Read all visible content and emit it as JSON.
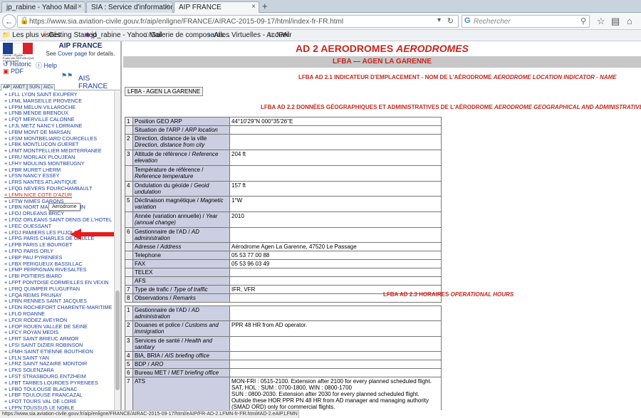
{
  "browser": {
    "tabs": [
      {
        "label": "jp_rabine - Yahoo Mail",
        "active": false
      },
      {
        "label": "SIA : Service d'information aéro...",
        "active": false
      },
      {
        "label": "AIP FRANCE",
        "active": true
      }
    ],
    "new_tab_label": "+",
    "tab_close": "×",
    "url": "https://www.sia.aviation-civile.gouv.fr/aip/enligne/FRANCE/AIRAC-2015-09-17/html/index-fr-FR.html",
    "search_placeholder": "Rechercher",
    "bookmarks": [
      "Les plus visités",
      "Getting Started",
      "jp_rabine - Yahoo Mail",
      "Galerie de composants...",
      "Ailes Virtuelles - Accueil",
      "JPAir"
    ],
    "status_url": "https://www.sia.aviation-civile.gouv.fr/aip/enligne/FRANCE/AIRAC-2015-09-17/html/eAIP/FR-AD-2.LFMN-fr-FR.html#AD-2.eAIP.LFMN"
  },
  "left": {
    "flag_caption": "Liberté • Égalité • Fraternité RÉPUBLIQUE FRANÇAISE",
    "title": "AIP FRANCE",
    "cover_prefix": "See ",
    "cover_link": "Cover page",
    "cover_suffix": " for details.",
    "historic": "Historic",
    "help": "Help",
    "pdf": "PDF",
    "ais_france": "AIS FRANCE",
    "tabs": [
      "AIP",
      "AMDT",
      "SUPs",
      "AICs"
    ],
    "items": [
      "LFLL LYON SAINT EXUPERY",
      "LFML MARSEILLE PROVENCE",
      "LFPM MELUN VILLAROCHE",
      "LFNB MENDE BRENOUX",
      "LFQT MERVILLE CALONNE",
      "LFJL METZ NANCY LORRAINE",
      "LFBM MONT DE MARSAN",
      "LFSM MONTBELIARD COURCELLES",
      "LFBK MONTLUCON GUERET",
      "LFMT MONTPELLIER MEDITERRANEE",
      "LFRU MORLAIX PLOUJEAN",
      "LFHY MOULINS MONTBEUGNY",
      "LFBR MURET LHERM",
      "LFSN NANCY ESSEY",
      "LFRS NANTES ATLANTIQUE",
      "LFQG NEVERS FOURCHAMBAULT",
      "LFMN NICE COTE D'AZUR",
      "LFTW NIMES GARONS",
      "LFBN NIORT MARAIS POITEVIN",
      "LFOJ ORLEANS BRICY",
      "LFOZ ORLEANS SAINT DENIS DE L'HOTEL",
      "LFEC OUESSANT",
      "LFDJ PAMIERS LES PUJOLS",
      "LFPG PARIS CHARLES DE GAULLE",
      "LFPB PARIS LE BOURGET",
      "LFPO PARIS ORLY",
      "LFBP PAU PYRENEES",
      "LFBX PERIGUEUX BASSILLAC",
      "LFMP PERPIGNAN RIVESALTES",
      "LFBI POITIERS BIARD",
      "LFPT PONTOISE CORMEILLES EN VEXIN",
      "LFRQ QUIMPER PLUGUFFAN",
      "LFQA REIMS PRUNAY",
      "LFRN RENNES SAINT JACQUES",
      "LFDN ROCHEFORT CHARENTE-MARITIME",
      "LFLO ROANNE",
      "LFCR RODEZ AVEYRON",
      "LFOP ROUEN VALLEE DE SEINE",
      "LFCY ROYAN MEDIS",
      "LFRT SAINT BRIEUC ARMOR",
      "LFSI SAINT DIZIER ROBINSON",
      "LFMH SAINT ETIENNE BOUTHEON",
      "LFLN SAINT YAN",
      "LFRZ SAINT NAZAIRE MONTOIR",
      "LFKS SOLENZARA",
      "LFST STRASBOURG ENTZHEIM",
      "LFBT TARBES LOURDES PYRENEES",
      "LFBO TOULOUSE BLAGNAC",
      "LFBF TOULOUSE FRANCAZAL",
      "LFOT TOURS VAL DE LOIRE",
      "LFPN TOUSSUS LE NOBLE"
    ],
    "selected_index": 16,
    "tooltip": "Aerodrome"
  },
  "main": {
    "title_plain": "AD 2  AERODROMES ",
    "title_italic": "AERODROMES",
    "band": "LFBA — AGEN LA GARENNE",
    "s1": {
      "plain": "LFBA AD 2.1   INDICATEUR D'EMPLACEMENT - NOM DE L'AÉRODROME ",
      "italic": "AERODROME LOCATION INDICATOR - NAME"
    },
    "button": "LFBA - AGEN LA GARENNE",
    "s2": {
      "plain": "LFBA AD 2.2   DONNÉES GÉOGRAPHIQUES ET ADMINISTRATIVES DE L'AÉRODROME ",
      "italic": "AERODROME GEOGRAPHICAL AND ADMINISTRATIVE DATA"
    },
    "table1": [
      {
        "n": "1",
        "fr": "Position GEO ARP",
        "en": "",
        "val": "44°10'29\"N 000°35'26\"E"
      },
      {
        "n": "",
        "fr": "Situation de l'ARP / ",
        "en": "ARP location",
        "val": ""
      },
      {
        "n": "2",
        "fr": "Direction, distance de la ville",
        "en": "Direction, distance from city",
        "val": ""
      },
      {
        "n": "3",
        "fr": "Altitude de référence / ",
        "en": "Reference elevation",
        "val": "204 ft"
      },
      {
        "n": "",
        "fr": "Température de référence / ",
        "en": "Reference temperature",
        "val": ""
      },
      {
        "n": "4",
        "fr": "Ondulation du géoïde / ",
        "en": "Geoid undulation",
        "val": "157 ft"
      },
      {
        "n": "5",
        "fr": "Déclinaison magnétique / ",
        "en": "Magnetic variation",
        "val": "1°W"
      },
      {
        "n": "",
        "fr": "Année (variation annuelle) / ",
        "en": "Year (annual change)",
        "val": "2010"
      },
      {
        "n": "6",
        "fr": "Gestionnaire de l'AD / ",
        "en": "AD administration",
        "val": ""
      },
      {
        "n": "",
        "fr": "Adresse / ",
        "en": "Address",
        "val": "Aérodrome Agen La Garenne, 47520 Le Passage"
      },
      {
        "n": "",
        "fr": "Telephone",
        "en": "",
        "val": "05 53 77 00 88"
      },
      {
        "n": "",
        "fr": "FAX",
        "en": "",
        "val": "05 53 96 03 49"
      },
      {
        "n": "",
        "fr": "TELEX",
        "en": "",
        "val": ""
      },
      {
        "n": "",
        "fr": "AFS",
        "en": "",
        "val": ""
      },
      {
        "n": "7",
        "fr": "Type de trafic / ",
        "en": "Type of traffic",
        "val": "IFR, VFR"
      },
      {
        "n": "8",
        "fr": "Observations / ",
        "en": "Remarks",
        "val": ""
      }
    ],
    "s3": {
      "plain": "LFBA AD 2.3   HORAIRES ",
      "italic": "OPERATIONAL HOURS"
    },
    "table2": [
      {
        "n": "1",
        "fr": "Gestionnaire de l'AD / ",
        "en": "AD administration",
        "val": ""
      },
      {
        "n": "2",
        "fr": "Douanes et police / ",
        "en": "Customs and immigration",
        "val": "PPR 48 HR from AD operator."
      },
      {
        "n": "3",
        "fr": "Services de santé / ",
        "en": "Health and sanitary",
        "val": ""
      },
      {
        "n": "4",
        "fr": "BIA, BRIA / ",
        "en": "AIS briefing office",
        "val": ""
      },
      {
        "n": "5",
        "fr": "BDP / ",
        "en": "ARO",
        "val": ""
      },
      {
        "n": "6",
        "fr": "Bureau MET / ",
        "en": "MET briefing office",
        "val": ""
      },
      {
        "n": "7",
        "fr": "ATS",
        "en": "",
        "val": "MON-FRI : 0515-2100. Extension after 2100 for every planned scheduled flight.\nSAT, HOL : SUM : 0700-1800, WIN : 0800-1700\nSUN : 0800-2030. Extension after 2030 for every planned scheduled flight.\nOutside these HOR PPR PN 48 HR from AD manager and managing authority (SMAD ORD) only for commercial flights."
      }
    ]
  },
  "colors": {
    "accent_red": "#c8251c",
    "link_blue": "#1b3fa0",
    "label_cell": "#cccfe2"
  }
}
